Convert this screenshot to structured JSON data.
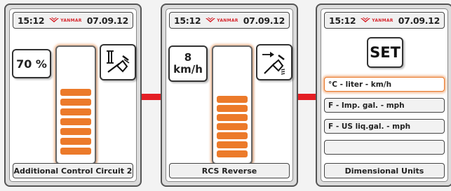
{
  "colors": {
    "accent": "#ec7a2a",
    "connector": "#e41e24",
    "brand": "#d6232a"
  },
  "screens": [
    {
      "header": {
        "time": "15:12",
        "brand": "YANMAR",
        "date": "07.09.12"
      },
      "value": "70 %",
      "icon": "auxiliary-circuit-II-icon",
      "gauge": {
        "level_segments": 6,
        "total_segments": 11
      },
      "footer": "Additional Control Circuit 2"
    },
    {
      "header": {
        "time": "15:12",
        "brand": "YANMAR",
        "date": "07.09.12"
      },
      "value_line1": "8",
      "value_line2": "km/h",
      "icon": "rcs-reverse-icon",
      "gauge": {
        "level_segments": 7,
        "total_segments": 11
      },
      "footer": "RCS Reverse"
    },
    {
      "header": {
        "time": "15:12",
        "brand": "YANMAR",
        "date": "07.09.12"
      },
      "set_label": "SET",
      "options": [
        {
          "label": "°C - liter - km/h",
          "selected": true
        },
        {
          "label": "F - Imp. gal. - mph",
          "selected": false
        },
        {
          "label": "F - US liq.gal. - mph",
          "selected": false
        },
        {
          "label": "",
          "selected": false
        }
      ],
      "footer": "Dimensional Units"
    }
  ]
}
